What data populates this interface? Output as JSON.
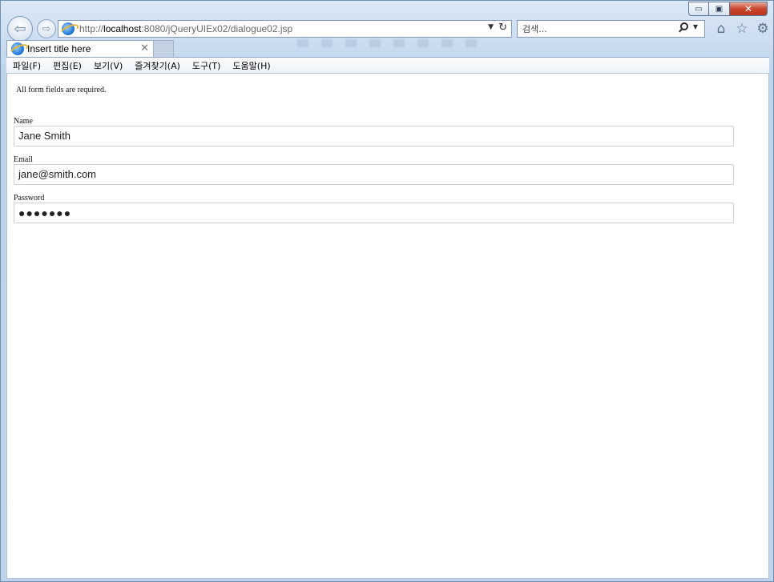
{
  "window": {
    "minimize_glyph": "▭",
    "maximize_glyph": "▣",
    "close_glyph": "✕"
  },
  "nav": {
    "back_glyph": "⇦",
    "forward_glyph": "⇨"
  },
  "address": {
    "prefix": "http://",
    "host": "localhost",
    "path": ":8080/jQueryUIEx02/dialogue02.jsp",
    "dropdown_glyph": "▼",
    "refresh_glyph": "↻"
  },
  "search": {
    "placeholder": "검색...",
    "dropdown_glyph": "▼"
  },
  "tools": {
    "home_glyph": "⌂",
    "favorites_glyph": "☆",
    "settings_glyph": "⚙"
  },
  "tab": {
    "title": "Insert title here",
    "close_glyph": "✕"
  },
  "menu": [
    {
      "label": "파일(F)"
    },
    {
      "label": "편집(E)"
    },
    {
      "label": "보기(V)"
    },
    {
      "label": "즐겨찾기(A)"
    },
    {
      "label": "도구(T)"
    },
    {
      "label": "도움말(H)"
    }
  ],
  "form": {
    "tip": "All form fields are required.",
    "name_label": "Name",
    "name_value": "Jane Smith",
    "email_label": "Email",
    "email_value": "jane@smith.com",
    "password_label": "Password",
    "password_value": "●●●●●●●"
  },
  "colors": {
    "chrome_bg": "#c5d9ee",
    "close_button": "#c8462c",
    "field_border": "#d2d2d2"
  },
  "icons": [
    "back-arrow-icon",
    "forward-arrow-icon",
    "ie-logo-icon",
    "refresh-icon",
    "search-icon",
    "home-icon",
    "star-icon",
    "gear-icon",
    "close-icon"
  ]
}
